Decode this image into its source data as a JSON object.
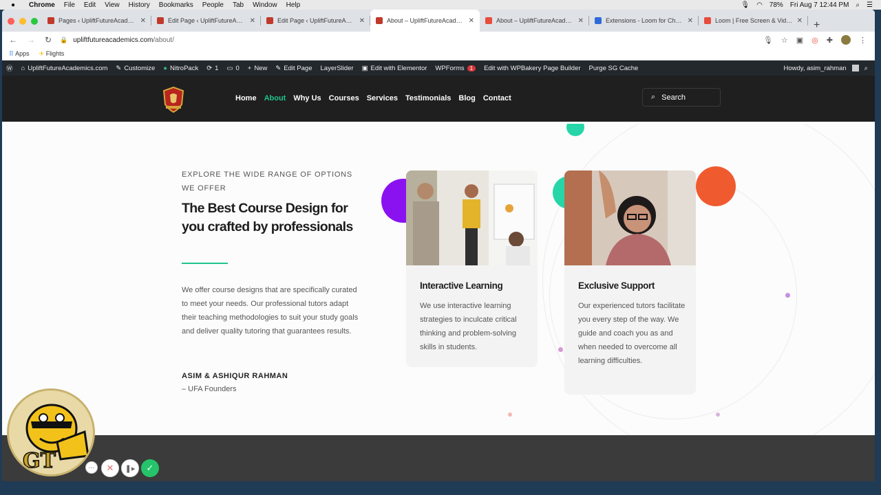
{
  "mac_menu": {
    "app": "Chrome",
    "items": [
      "File",
      "Edit",
      "View",
      "History",
      "Bookmarks",
      "People",
      "Tab",
      "Window",
      "Help"
    ],
    "battery": "78%",
    "clock": "Fri Aug 7  12:44 PM"
  },
  "browser": {
    "tabs": [
      {
        "title": "Pages ‹ UpliftFutureAcademics",
        "color": "#c0392b"
      },
      {
        "title": "Edit Page ‹ UpliftFutureAcadem",
        "color": "#c0392b"
      },
      {
        "title": "Edit Page ‹ UpliftFutureAcadem",
        "color": "#c0392b"
      },
      {
        "title": "About – UpliftFutureAcademics",
        "color": "#c0392b"
      },
      {
        "title": "About – UpliftFutureAcademics",
        "color": "#e74c3c"
      },
      {
        "title": "Extensions - Loom for Chrome",
        "color": "#2e6bd8"
      },
      {
        "title": "Loom | Free Screen & Video Re",
        "color": "#e74c3c"
      }
    ],
    "url_host": "upliftfutureacademics.com",
    "url_path": "/about/",
    "bookmarks": [
      "Apps",
      "Flights"
    ]
  },
  "wp_admin": {
    "site": "UpliftFutureAcademics.com",
    "customize": "Customize",
    "nitropack": "NitroPack",
    "updates": "1",
    "comments": "0",
    "new": "New",
    "edit_page": "Edit Page",
    "layerslider": "LayerSlider",
    "elementor": "Edit with Elementor",
    "wpforms": "WPForms",
    "wpforms_badge": "1",
    "wpbakery": "Edit with WPBakery Page Builder",
    "purge": "Purge SG Cache",
    "howdy": "Howdy, asim_rahman"
  },
  "site_nav": {
    "items": [
      "Home",
      "About",
      "Why Us",
      "Courses",
      "Services",
      "Testimonials",
      "Blog",
      "Contact"
    ],
    "search_placeholder": "Search"
  },
  "main": {
    "eyebrow": "EXPLORE THE WIDE RANGE OF OPTIONS WE OFFER",
    "heading": "The Best Course Design for you crafted by professionals",
    "description": "We offer course designs that are specifically curated to meet your needs. Our professional tutors adapt their teaching methodologies to suit your study goals and deliver quality tutoring that guarantees results.",
    "author": "ASIM & ASHIQUR RAHMAN",
    "role": "– UFA Founders"
  },
  "cards": [
    {
      "title": "Interactive Learning",
      "text": "We use interactive learning strategies to inculcate critical thinking and problem-solving skills in students."
    },
    {
      "title": "Exclusive Support",
      "text": "Our experienced tutors facilitate you every step of the way. We guide and coach you as and when needed to overcome all learning difficulties."
    }
  ],
  "colors": {
    "accent": "#1fc38f",
    "purple": "#8a12f0",
    "orange": "#f05a2f",
    "teal": "#27d6a8"
  }
}
